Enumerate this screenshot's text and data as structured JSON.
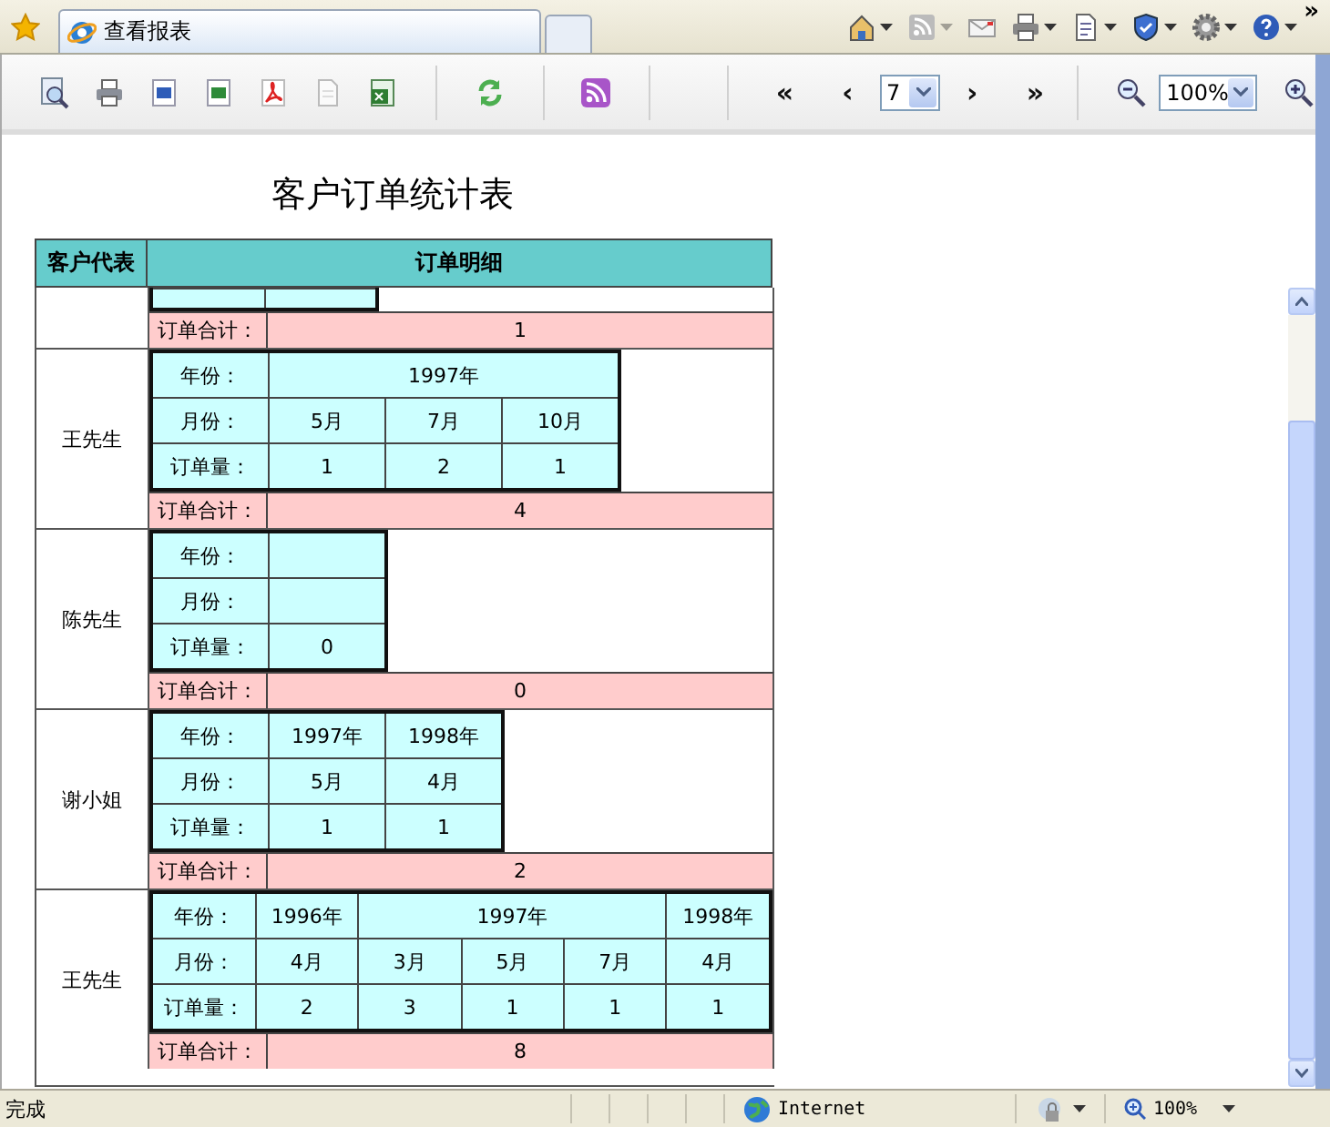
{
  "browser": {
    "tab_title": "查看报表",
    "overflow": "»"
  },
  "toolbar": {
    "nav": [
      "«",
      "‹",
      "›",
      "»"
    ],
    "page": "7",
    "zoom": "100%"
  },
  "report": {
    "title": "客户订单统计表",
    "columns": [
      "客户代表",
      "订单明细"
    ],
    "partial_group": {
      "total_label": "订单合计：",
      "total": "1"
    },
    "groups": [
      {
        "customer": "王先生",
        "row_labels": [
          "年份：",
          "月份：",
          "订单量："
        ],
        "years": [
          {
            "year": "1997年",
            "months": [
              {
                "month": "5月",
                "quantity": "1"
              },
              {
                "month": "7月",
                "quantity": "2"
              },
              {
                "month": "10月",
                "quantity": "1"
              }
            ]
          }
        ],
        "total_label": "订单合计：",
        "total": "4"
      },
      {
        "customer": "陈先生",
        "row_labels": [
          "年份：",
          "月份：",
          "订单量："
        ],
        "years": [
          {
            "months": [
              {
                "quantity": "0"
              }
            ]
          }
        ],
        "total_label": "订单合计：",
        "total": "0"
      },
      {
        "customer": "谢小姐",
        "row_labels": [
          "年份：",
          "月份：",
          "订单量："
        ],
        "years": [
          {
            "year": "1997年",
            "months": [
              {
                "month": "5月",
                "quantity": "1"
              }
            ]
          },
          {
            "year": "1998年",
            "months": [
              {
                "month": "4月",
                "quantity": "1"
              }
            ]
          }
        ],
        "total_label": "订单合计：",
        "total": "2"
      },
      {
        "customer": "王先生",
        "row_labels": [
          "年份：",
          "月份：",
          "订单量："
        ],
        "years": [
          {
            "year": "1996年",
            "months": [
              {
                "month": "4月",
                "quantity": "2"
              }
            ]
          },
          {
            "year": "1997年",
            "months": [
              {
                "month": "3月",
                "quantity": "3"
              },
              {
                "month": "5月",
                "quantity": "1"
              },
              {
                "month": "7月",
                "quantity": "1"
              }
            ]
          },
          {
            "year": "1998年",
            "months": [
              {
                "month": "4月",
                "quantity": "1"
              }
            ]
          }
        ],
        "total_label": "订单合计：",
        "total": "8"
      }
    ]
  },
  "status_bar": {
    "status": "完成",
    "zone": "Internet",
    "zoom": "100%"
  }
}
